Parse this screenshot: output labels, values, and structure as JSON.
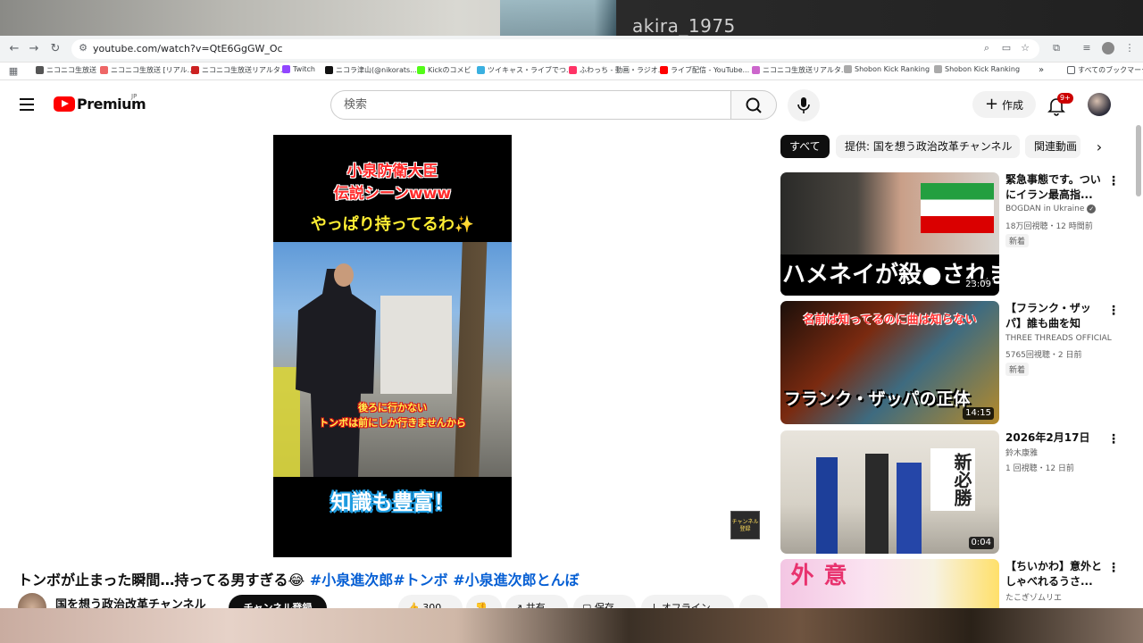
{
  "overlay": {
    "streamer_name": "akira_1975"
  },
  "browser": {
    "url": "youtube.com/watch?v=QtE6GgGW_Oc",
    "bookmarks": [
      {
        "label": "ニコニコ生放送"
      },
      {
        "label": "ニコニコ生放送 [リアル..."
      },
      {
        "label": "ニコニコ生放送リアルタ..."
      },
      {
        "label": "Twitch"
      },
      {
        "label": "ニコラ津山(@nikorats..."
      },
      {
        "label": "Kickのコメビ"
      },
      {
        "label": "ツイキャス・ライブでつ..."
      },
      {
        "label": "ふわっち - 動画・ラジオ..."
      },
      {
        "label": "ライブ配信 - YouTube..."
      },
      {
        "label": "ニコニコ生放送リアルタ..."
      },
      {
        "label": "Shobon Kick Ranking"
      },
      {
        "label": "Shobon Kick Ranking"
      },
      {
        "label": "»"
      },
      {
        "label": "すべてのブックマーク"
      }
    ]
  },
  "header": {
    "brand": "Premium",
    "region": "JP",
    "search_placeholder": "検索",
    "create_label": "作成",
    "notification_badge": "9+"
  },
  "video": {
    "overlay_text": {
      "line1": "小泉防衛大臣",
      "line2": "伝説シーンwww",
      "line3": "やっぱり持ってるわ✨",
      "caption1": "後ろに行かない",
      "caption2": "トンボは前にしか行きませんから",
      "bottom": "知識も豊富！"
    },
    "watermark": "チャンネル登録",
    "title": "トンボが止まった瞬間…持ってる男すぎる😂",
    "hashtags": "#小泉進次郎#トンボ #小泉進次郎とんぼ",
    "channel_name": "国を想う政治改革チャンネル",
    "subscribe_label": "チャンネル登録",
    "actions": {
      "likes": "300",
      "share": "共有",
      "save": "保存",
      "offline": "オフライン"
    }
  },
  "chips": [
    "すべて",
    "提供: 国を想う政治改革チャンネル",
    "関連動画"
  ],
  "recommendations": [
    {
      "title": "緊急事態です。ついにイラン最高指...",
      "channel": "BOGDAN in Ukraine",
      "verified": true,
      "meta": "18万回視聴・12 時間前",
      "badge": "新着",
      "duration": "23:09",
      "thumb_text": "ハメネイが殺●されました"
    },
    {
      "title": "【フランク・ザッパ】誰も曲を知ら...",
      "channel": "THREE THREADS OFFICIAL",
      "meta": "5765回視聴・2 日前",
      "badge": "新着",
      "duration": "14:15",
      "thumb_text_top": "名前は知ってるのに曲は知らない",
      "thumb_text_bottom": "フランク・ザッパの正体"
    },
    {
      "title": "2026年2月17日",
      "channel": "鈴木康雅",
      "meta": "1 回視聴・12 日前",
      "duration": "0:04",
      "thumb_text": "新必勝"
    },
    {
      "title": "【ちいかわ】意外としゃべれるうさ...",
      "channel": "たこぎゾムリエ",
      "thumb_text": "意外"
    }
  ]
}
